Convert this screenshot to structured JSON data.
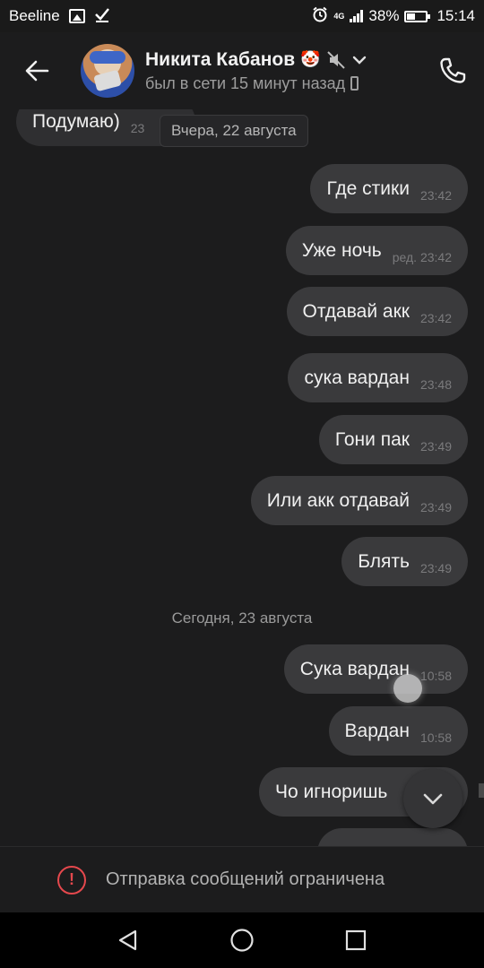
{
  "status_bar": {
    "carrier": "Beeline",
    "network": "4G",
    "battery": "38%",
    "battery_level": 0.38,
    "time": "15:14"
  },
  "header": {
    "contact_name": "Никита Кабанов",
    "emoji": "🤡",
    "last_seen": "был в сети 15 минут назад"
  },
  "chat": {
    "partial_incoming": {
      "text": "Подумаю)",
      "time": "23"
    },
    "date_chip": "Вчера, 22 августа",
    "messages_yesterday": [
      {
        "text": "Где стики",
        "time": "23:42"
      },
      {
        "text": "Уже ночь",
        "time": "ред. 23:42"
      },
      {
        "text": "Отдавай акк",
        "time": "23:42"
      },
      {
        "text": "сука вардан",
        "time": "23:48"
      },
      {
        "text": "Гони пак",
        "time": "23:49"
      },
      {
        "text": "Или акк отдавай",
        "time": "23:49"
      },
      {
        "text": "Блять",
        "time": "23:49"
      }
    ],
    "date_today": "Сегодня, 23 августа",
    "messages_today": [
      {
        "text": "Сука вардан",
        "time": "10:58"
      },
      {
        "text": "Вардан",
        "time": "10:58"
      },
      {
        "text": "Чо игноришь",
        "time": ""
      }
    ]
  },
  "restricted": {
    "text": "Отправка сообщений ограничена"
  },
  "colors": {
    "accent_warning": "#e5484d",
    "bubble_out": "#3a3a3c",
    "background": "#1c1c1d"
  },
  "icons": [
    "image-icon",
    "check-icon",
    "alarm-icon",
    "signal-icon",
    "battery-icon",
    "back-arrow-icon",
    "mute-icon",
    "chevron-down-icon",
    "phone-icon",
    "warning-icon",
    "nav-back-icon",
    "nav-home-icon",
    "nav-recents-icon"
  ]
}
